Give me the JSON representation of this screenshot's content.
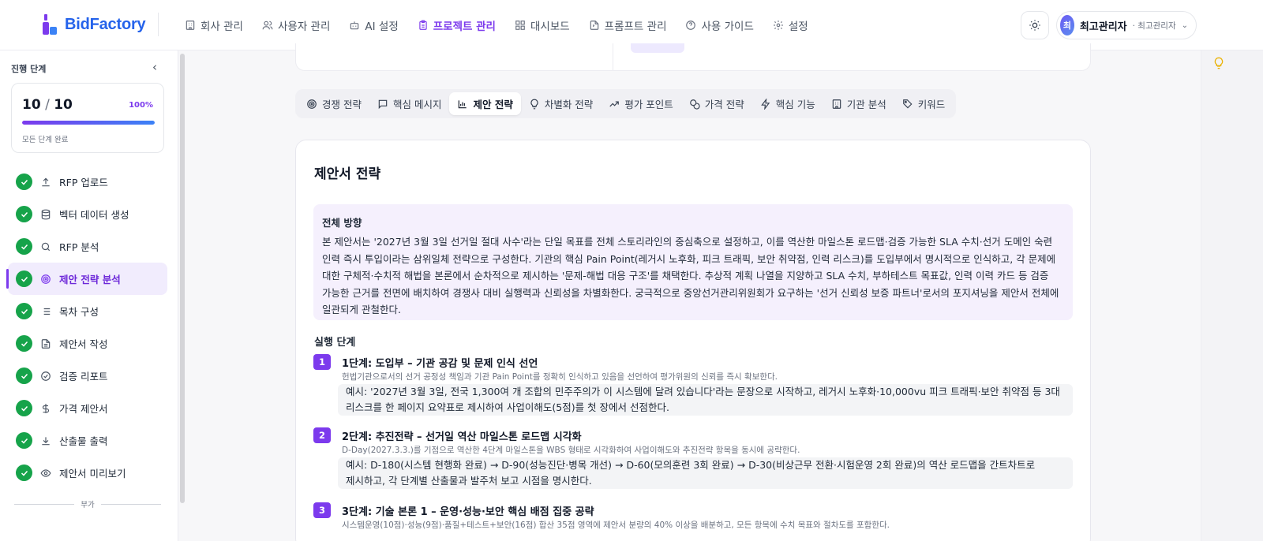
{
  "app": {
    "name": "BidFactory"
  },
  "nav": [
    {
      "label": "회사 관리",
      "icon": "building-icon"
    },
    {
      "label": "사용자 관리",
      "icon": "users-icon"
    },
    {
      "label": "AI 설정",
      "icon": "bot-icon"
    },
    {
      "label": "프로젝트 관리",
      "icon": "clipboard-icon",
      "active": true
    },
    {
      "label": "대시보드",
      "icon": "dashboard-icon"
    },
    {
      "label": "프롬프트 관리",
      "icon": "prompt-icon"
    },
    {
      "label": "사용 가이드",
      "icon": "help-icon"
    },
    {
      "label": "설정",
      "icon": "gear-icon"
    }
  ],
  "user": {
    "initial": "최",
    "name": "최고관리자",
    "role": "· 최고관리자"
  },
  "sidebar": {
    "heading": "진행 단계",
    "progress": {
      "count": "10",
      "total": "10",
      "percent_label": "100%",
      "fraction": 1.0,
      "caption": "모든 단계 완료"
    },
    "steps": [
      {
        "label": "RFP 업로드",
        "icon": "upload-icon",
        "done": true
      },
      {
        "label": "벡터 데이터 생성",
        "icon": "database-icon",
        "done": true
      },
      {
        "label": "RFP 분석",
        "icon": "search-icon",
        "done": true
      },
      {
        "label": "제안 전략 분석",
        "icon": "target-icon",
        "done": true,
        "active": true
      },
      {
        "label": "목차 구성",
        "icon": "list-icon",
        "done": true
      },
      {
        "label": "제안서 작성",
        "icon": "document-icon",
        "done": true
      },
      {
        "label": "검증 리포트",
        "icon": "check-circle-icon",
        "done": true
      },
      {
        "label": "가격 제안서",
        "icon": "dollar-icon",
        "done": true
      },
      {
        "label": "산출물 출력",
        "icon": "download-icon",
        "done": true
      },
      {
        "label": "제안서 미리보기",
        "icon": "eye-icon",
        "done": true
      }
    ],
    "extra_label": "부가"
  },
  "tabs": [
    {
      "label": "경쟁 전략",
      "icon": "target-icon"
    },
    {
      "label": "핵심 메시지",
      "icon": "message-icon"
    },
    {
      "label": "제안 전략",
      "icon": "bar-chart-icon",
      "active": true
    },
    {
      "label": "차별화 전략",
      "icon": "lightbulb-icon"
    },
    {
      "label": "평가 포인트",
      "icon": "trend-icon"
    },
    {
      "label": "가격 전략",
      "icon": "coins-icon"
    },
    {
      "label": "핵심 기능",
      "icon": "zap-icon"
    },
    {
      "label": "기관 분석",
      "icon": "building-icon"
    },
    {
      "label": "키워드",
      "icon": "tag-icon"
    }
  ],
  "strategy": {
    "title": "제안서 전략",
    "overview_title": "전체 방향",
    "overview_text": "본 제안서는 '2027년 3월 3일 선거일 절대 사수'라는 단일 목표를 전체 스토리라인의 중심축으로 설정하고, 이를 역산한 마일스톤 로드맵·검증 가능한 SLA 수치·선거 도메인 숙련 인력 즉시 투입이라는 삼위일체 전략으로 구성한다. 기관의 핵심 Pain Point(레거시 노후화, 피크 트래픽, 보안 취약점, 인력 리스크)를 도입부에서 명시적으로 인식하고, 각 문제에 대한 구체적·수치적 해법을 본론에서 순차적으로 제시하는 '문제-해법 대응 구조'를 채택한다. 추상적 계획 나열을 지양하고 SLA 수치, 부하테스트 목표값, 인력 이력 카드 등 검증 가능한 근거를 전면에 배치하여 경쟁사 대비 실행력과 신뢰성을 차별화한다. 궁극적으로 중앙선거관리위원회가 요구하는 '선거 신뢰성 보증 파트너'로서의 포지셔닝을 제안서 전체에 일관되게 관철한다.",
    "phases_heading": "실행 단계",
    "phases": [
      {
        "num": "1",
        "title": "1단계: 도입부 – 기관 공감 및 문제 인식 선언",
        "desc": "헌법기관으로서의 선거 공정성 책임과 기관 Pain Point를 정확히 인식하고 있음을 선언하여 평가위원의 신뢰를 즉시 확보한다.",
        "example": "예시: '2027년 3월 3일, 전국 1,300여 개 조합의 민주주의가 이 시스템에 달려 있습니다'라는 문장으로 시작하고, 레거시 노후화·10,000vu 피크 트래픽·보안 취약점 등 3대 리스크를 한 페이지 요약표로 제시하여 사업이해도(5점)를 첫 장에서 선점한다."
      },
      {
        "num": "2",
        "title": "2단계: 추진전략 – 선거일 역산 마일스톤 로드맵 시각화",
        "desc": "D-Day(2027.3.3.)를 기점으로 역산한 4단계 마일스톤을 WBS 형태로 시각화하여 사업이해도와 추진전략 항목을 동시에 공략한다.",
        "example": "예시: D-180(시스템 현행화 완료) → D-90(성능진단·병목 개선) → D-60(모의훈련 3회 완료) → D-30(비상근무 전환·시험운영 2회 완료)의 역산 로드맵을 간트차트로 제시하고, 각 단계별 산출물과 발주처 보고 시점을 명시한다."
      },
      {
        "num": "3",
        "title": "3단계: 기술 본론 1 – 운영·성능·보안 핵심 배점 집중 공략",
        "desc": "시스템운영(10점)·성능(9점)·품질+테스트+보안(16점) 합산 35점 영역에 제안서 분량의 40% 이상을 배분하고, 모든 항목에 수치 목표와 절차도를 포함한다."
      }
    ]
  }
}
